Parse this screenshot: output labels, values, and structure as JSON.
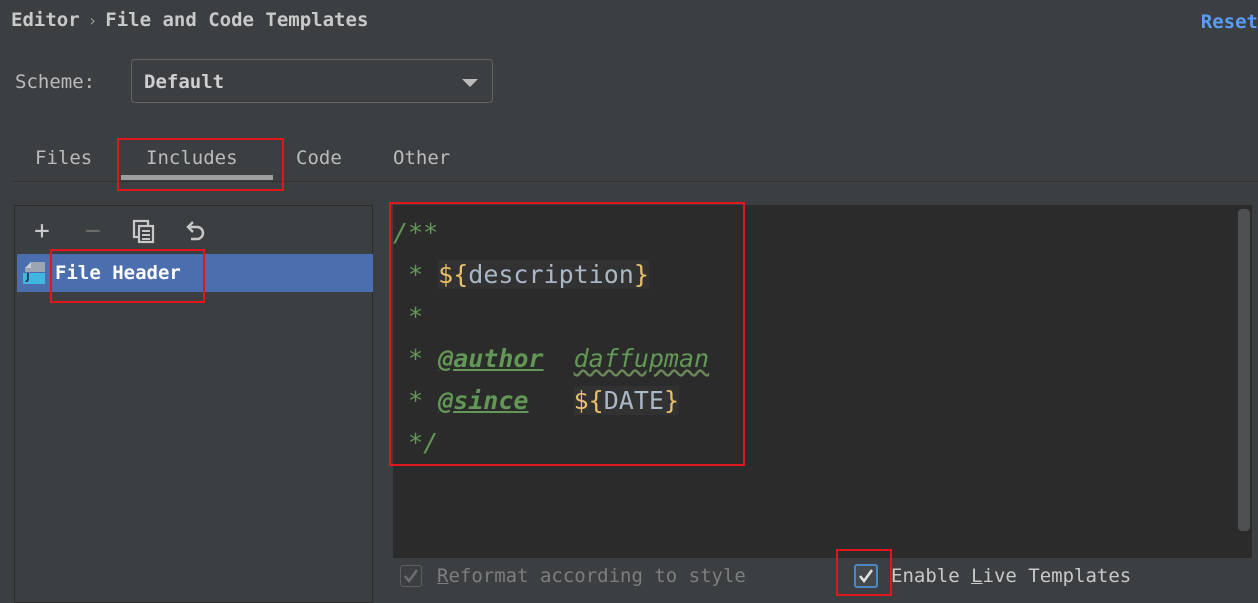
{
  "breadcrumb": {
    "parent": "Editor",
    "separator": "›",
    "current": "File and Code Templates"
  },
  "reset_label": "Reset",
  "scheme": {
    "label": "Scheme:",
    "value": "Default"
  },
  "tabs": [
    {
      "label": "Files"
    },
    {
      "label": "Includes",
      "selected": true
    },
    {
      "label": "Code"
    },
    {
      "label": "Other"
    }
  ],
  "toolbar": {
    "add": "+",
    "remove": "−"
  },
  "templates": [
    {
      "label": "File Header",
      "selected": true,
      "icon": "java-file-icon",
      "icon_letter": "J"
    }
  ],
  "editor": {
    "lines": {
      "l1": "/**",
      "l2_prefix": " * ",
      "l2_dollar": "${",
      "l2_var": "description",
      "l2_close": "}",
      "l3": " *",
      "l4_prefix": " * ",
      "l4_tag": "@author",
      "l4_value": "daffupman",
      "l5_prefix": " * ",
      "l5_tag": "@since",
      "l5_dollar": "${",
      "l5_var": "DATE",
      "l5_close": "}",
      "l6": " */"
    }
  },
  "options": {
    "reformat_mnemonic": "R",
    "reformat_rest": "eformat according to style",
    "reformat_checked": true,
    "reformat_enabled": false,
    "live_pre": "Enable ",
    "live_mnemonic": "L",
    "live_rest": "ive Templates",
    "live_checked": true
  },
  "colors": {
    "background": "#3c3f41",
    "editor_bg": "#2b2b2b",
    "selection": "#4b6eaf",
    "accent_link": "#589df6",
    "highlight_box": "#e3161b",
    "comment": "#629755",
    "template_var": "#e8bf6a"
  }
}
